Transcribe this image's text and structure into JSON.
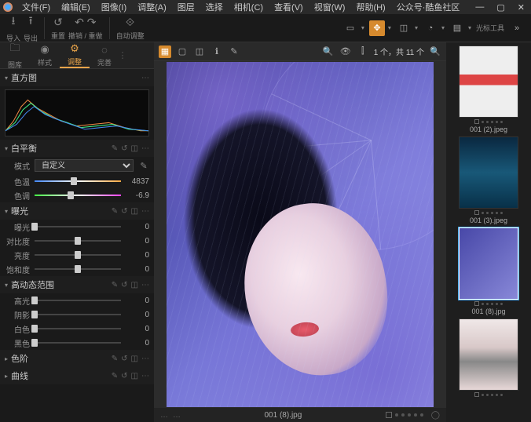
{
  "menu": {
    "items": [
      "文件(F)",
      "编辑(E)",
      "图像(I)",
      "调整(A)",
      "图层",
      "选择",
      "相机(C)",
      "查看(V)",
      "视窗(W)",
      "帮助(H)",
      "公众号·酷鱼社区"
    ]
  },
  "toolbar": {
    "import": "导入",
    "export": "导出",
    "reset": "重置",
    "undo_redo": "撤销 / 重做",
    "auto_adjust": "自动调整",
    "cursor_tools": "光标工具"
  },
  "tabs": {
    "library": "图库",
    "styles": "样式",
    "adjust": "调整",
    "refine": "完善"
  },
  "viewbar": {
    "counter": "1 个，共 11 个"
  },
  "panels": {
    "histogram": {
      "title": "直方图"
    },
    "wb": {
      "title": "白平衡",
      "mode_label": "模式",
      "mode_value": "自定义",
      "temp_label": "色温",
      "temp_value": "4837",
      "tint_label": "色调",
      "tint_value": "-6.9"
    },
    "exposure": {
      "title": "曝光",
      "rows": [
        {
          "label": "曝光",
          "value": "0"
        },
        {
          "label": "对比度",
          "value": "0"
        },
        {
          "label": "亮度",
          "value": "0"
        },
        {
          "label": "饱和度",
          "value": "0"
        }
      ]
    },
    "hdr": {
      "title": "高动态范围",
      "rows": [
        {
          "label": "高光",
          "value": "0"
        },
        {
          "label": "阴影",
          "value": "0"
        },
        {
          "label": "白色",
          "value": "0"
        },
        {
          "label": "黑色",
          "value": "0"
        }
      ]
    },
    "levels": {
      "title": "色阶"
    },
    "curves": {
      "title": "曲线"
    }
  },
  "canvas": {
    "filename": "001 (8).jpg"
  },
  "thumbs": [
    {
      "name": "001 (2).jpeg",
      "cls": "t1"
    },
    {
      "name": "001 (3).jpeg",
      "cls": "t2"
    },
    {
      "name": "001 (8).jpg",
      "cls": "t3",
      "selected": true
    },
    {
      "name": "",
      "cls": "t4"
    }
  ]
}
